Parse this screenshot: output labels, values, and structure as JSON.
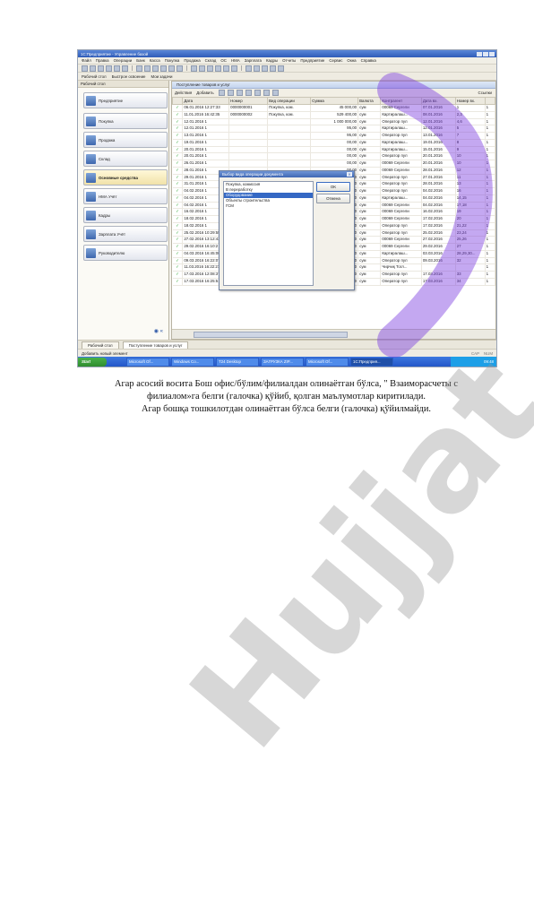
{
  "app": {
    "title": "1С:Предприятие - Управление базой",
    "menu": [
      "Файл",
      "Правка",
      "Операции",
      "Банк",
      "Касса",
      "Покупка",
      "Продажа",
      "Склад",
      "ОС",
      "НМА",
      "Зарплата",
      "Кадры",
      "Отчеты",
      "Предприятие",
      "Сервис",
      "Окна",
      "Справка"
    ],
    "toolbar2": [
      "Рабочий стол",
      "Быстрое освоение",
      "Мои задачи"
    ]
  },
  "panel": {
    "title": "Рабочий стол",
    "items": [
      "Предприятие",
      "Покупка",
      "Продажа",
      "Склад",
      "Основные средства",
      "НМА Учёт",
      "Кадры",
      "Зарплата Учёт",
      "Руководителю"
    ]
  },
  "document": {
    "title": "Поступление товаров и услуг",
    "actions_label": "Действия",
    "add_label": "Добавить",
    "offices_label": "Ссылки",
    "columns": [
      "",
      "Дата",
      "Номер",
      "Вид операции",
      "Сумма",
      "Валюта",
      "Контрагент",
      "Дата вх.",
      "Номер вх.",
      ""
    ],
    "rows": [
      [
        "✓",
        "06.01.2016 12:27:33",
        "0000000001",
        "Покупка, ком.",
        "45 000,00",
        "сум",
        "00069 Сергели",
        "07.01.2016",
        "1",
        "1"
      ],
      [
        "✓",
        "11.01.2016 16:42:35",
        "0000000002",
        "Покупка, ком.",
        "529 400,00",
        "сум",
        "Картиралаш...",
        "08.01.2016",
        "2,3",
        "1"
      ],
      [
        "✓",
        "12.01.2016 1",
        "",
        "",
        "1 000 000,00",
        "сум",
        "Оператор пул",
        "12.01.2016",
        "4,6",
        "1"
      ],
      [
        "✓",
        "12.01.2016 1",
        "",
        "",
        "95,00",
        "сум",
        "Картиралаш...",
        "12.01.2016",
        "5",
        "1"
      ],
      [
        "✓",
        "13.01.2016 1",
        "",
        "",
        "95,00",
        "сум",
        "Оператор пул",
        "13.01.2016",
        "7",
        "1"
      ],
      [
        "✓",
        "19.01.2016 1",
        "",
        "",
        "00,00",
        "сум",
        "Картиралаш...",
        "19.01.2016",
        "8",
        "1"
      ],
      [
        "✓",
        "20.01.2016 1",
        "",
        "",
        "00,00",
        "сум",
        "Картиралаш...",
        "15.01.2016",
        "9",
        "1"
      ],
      [
        "✓",
        "20.01.2016 1",
        "",
        "",
        "00,00",
        "сум",
        "Оператор пул",
        "20.01.2016",
        "10",
        "1"
      ],
      [
        "✓",
        "26.01.2016 1",
        "",
        "",
        "00,00",
        "сум",
        "00069 Сергели",
        "20.01.2016",
        "10",
        "1"
      ],
      [
        "✓",
        "28.01.2016 1",
        "",
        "",
        "00,00",
        "сум",
        "00069 Сергели",
        "28.01.2016",
        "12",
        "1"
      ],
      [
        "✓",
        "29.01.2016 1",
        "",
        "",
        "00,00",
        "сум",
        "Оператор пул",
        "27.01.2016",
        "11",
        "1"
      ],
      [
        "✓",
        "31.01.2016 1",
        "",
        "",
        "00,00",
        "сум",
        "Оператор пул",
        "28.01.2016",
        "13",
        "1"
      ],
      [
        "✓",
        "04.02.2016 1",
        "",
        "",
        "00,00",
        "сум",
        "Оператор пул",
        "04.02.2016",
        "16",
        "1"
      ],
      [
        "✓",
        "04.02.2016 1",
        "",
        "",
        "00,00",
        "сум",
        "Картиралаш...",
        "04.02.2016",
        "14,15",
        "1"
      ],
      [
        "✓",
        "04.02.2016 1",
        "",
        "",
        "00,00",
        "сум",
        "00069 Сергели",
        "04.02.2016",
        "17,18",
        "1"
      ],
      [
        "✓",
        "16.02.2016 1",
        "",
        "",
        "00,00",
        "сум",
        "00069 Сергели",
        "16.02.2016",
        "19",
        "1"
      ],
      [
        "✓",
        "18.02.2016 1",
        "",
        "",
        "00,00",
        "сум",
        "00069 Сергели",
        "17.02.2016",
        "20",
        "1"
      ],
      [
        "✓",
        "18.02.2016 1",
        "",
        "",
        "00,00",
        "сум",
        "Оператор пул",
        "17.02.2016",
        "21,22",
        "1"
      ],
      [
        "✓",
        "25.02.2016 10:29:55",
        "0000000019",
        "Покупка, ком.",
        "423 400,00",
        "сум",
        "Оператор пул",
        "25.02.2016",
        "23,24",
        "1"
      ],
      [
        "✓",
        "27.02.2016 13:12:43",
        "0000000020",
        "Покупка, ком.",
        "1 075 000,00",
        "сум",
        "00069 Сергели",
        "27.02.2016",
        "25,26",
        "1"
      ],
      [
        "✓",
        "29.02.2016 16:10:2",
        "0000000021",
        "Покупка, ком.",
        "42 600,00",
        "сум",
        "00069 Сергели",
        "29.02.2016",
        "27",
        "1"
      ],
      [
        "✓",
        "04.03.2016 16:45:00",
        "0000000022",
        "Покупка, ком.",
        "1 468 900,00",
        "сум",
        "Картиралаш...",
        "03.03.2016",
        "28,29,30...",
        "1"
      ],
      [
        "✓",
        "09.03.2016 16:22:07",
        "0000000023",
        "Покупка, ком.",
        "5 379 330,00",
        "сум",
        "Оператор пул",
        "09.03.2016",
        "32",
        "1"
      ],
      [
        "✓",
        "11.03.2016 16:22:27",
        "0000000024",
        "Покупка, ком.",
        "64 000,00",
        "сум",
        "Чирчиқ Тогл...",
        "",
        "",
        "1"
      ],
      [
        "✓",
        "17.03.2016 12:08:37",
        "0000000025",
        "Покупка, ком.",
        "150 000,00",
        "сум",
        "Оператор пул",
        "17.03.2016",
        "33",
        "1"
      ],
      [
        "✓",
        "17.03.2016 16:25:51",
        "0000000026",
        "Покупка, ком.",
        "5 379 330,00",
        "сум",
        "Оператор пул",
        "17.03.2016",
        "34",
        "1"
      ]
    ]
  },
  "dialog": {
    "title": "Выбор вида операции документа",
    "options": [
      "Покупка, комиссия",
      "В переработку",
      "Оборудование",
      "Объекты строительства",
      "ГСМ"
    ],
    "selected_index": 2,
    "ok_label": "OK",
    "cancel_label": "Отмена"
  },
  "bottom_tabs": [
    "Рабочий стол",
    "Поступление товаров и услуг"
  ],
  "status": {
    "text": "Добавить новый элемент",
    "caps": "CAP",
    "num": "NUM"
  },
  "taskbar": {
    "start_label": "Start",
    "items": [
      "Microsoft Of...",
      "Windows Co...",
      "Т24 Desktop",
      "ЗАГРУЗКА ZIP...",
      "Microsoft Of...",
      "1С:Предприя..."
    ],
    "active_index": 5,
    "time": "09:48"
  },
  "caption": [
    "Агар асосий восита Бош офис/бўлим/филиалдан олинаётган бўлса, \" Взаиморасчеты с",
    "филиалом»га белги (галочка) қўйиб, қолган маълумотлар киритилади.",
    "Агар бошқа тошкилотдан олинаётган бўлса белги (галочка) қўйилмайди."
  ],
  "watermark": "Hujjat",
  "colors": {
    "accent": "#3468c4",
    "watermark": "#969696",
    "watermark_purple": "#7d3fe0"
  }
}
